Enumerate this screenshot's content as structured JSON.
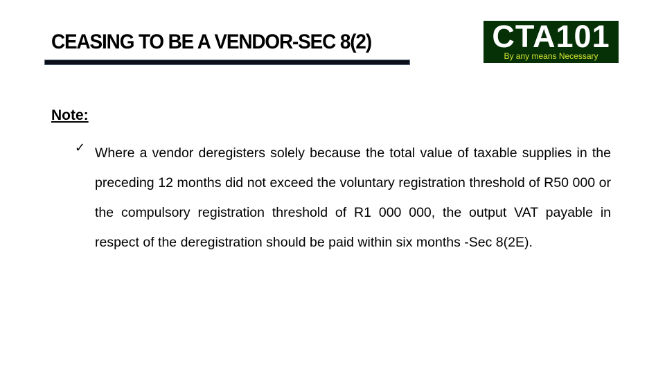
{
  "slide": {
    "title": "CEASING TO BE A VENDOR-SEC 8(2)",
    "logo": {
      "main_text": "CTA101",
      "tagline": "By any means Necessary",
      "background_color": "#063006",
      "tagline_color": "#d6e830"
    },
    "note_label": "Note:",
    "bullets": [
      {
        "icon": "checkmark-icon",
        "glyph": "✓",
        "text": "Where a vendor deregisters solely because the total value of taxable supplies in the preceding 12 months did not exceed the voluntary registration threshold of R50 000 or the compulsory registration threshold of R1 000 000, the output VAT payable in respect of the deregistration should be paid within six months -Sec 8(2E)."
      }
    ]
  }
}
